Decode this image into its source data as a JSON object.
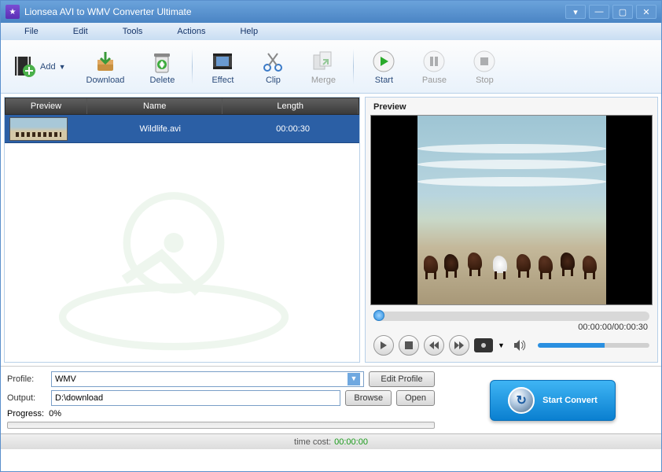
{
  "app": {
    "title": "Lionsea AVI to WMV Converter Ultimate"
  },
  "menu": {
    "file": "File",
    "edit": "Edit",
    "tools": "Tools",
    "actions": "Actions",
    "help": "Help"
  },
  "toolbar": {
    "add": "Add",
    "download": "Download",
    "delete": "Delete",
    "effect": "Effect",
    "clip": "Clip",
    "merge": "Merge",
    "start": "Start",
    "pause": "Pause",
    "stop": "Stop"
  },
  "list": {
    "headers": {
      "preview": "Preview",
      "name": "Name",
      "length": "Length"
    },
    "rows": [
      {
        "name": "Wildlife.avi",
        "length": "00:00:30"
      }
    ]
  },
  "preview": {
    "title": "Preview",
    "time": "00:00:00/00:00:30"
  },
  "settings": {
    "profile_label": "Profile:",
    "profile_value": "WMV",
    "edit_profile": "Edit Profile",
    "output_label": "Output:",
    "output_value": "D:\\download",
    "browse": "Browse",
    "open": "Open",
    "progress_label": "Progress:",
    "progress_value": "0%"
  },
  "convert": {
    "label": "Start Convert"
  },
  "footer": {
    "label": "time cost:",
    "value": "00:00:00"
  },
  "colors": {
    "accent": "#2a8fe0",
    "titlebar": "#4a84c4"
  }
}
